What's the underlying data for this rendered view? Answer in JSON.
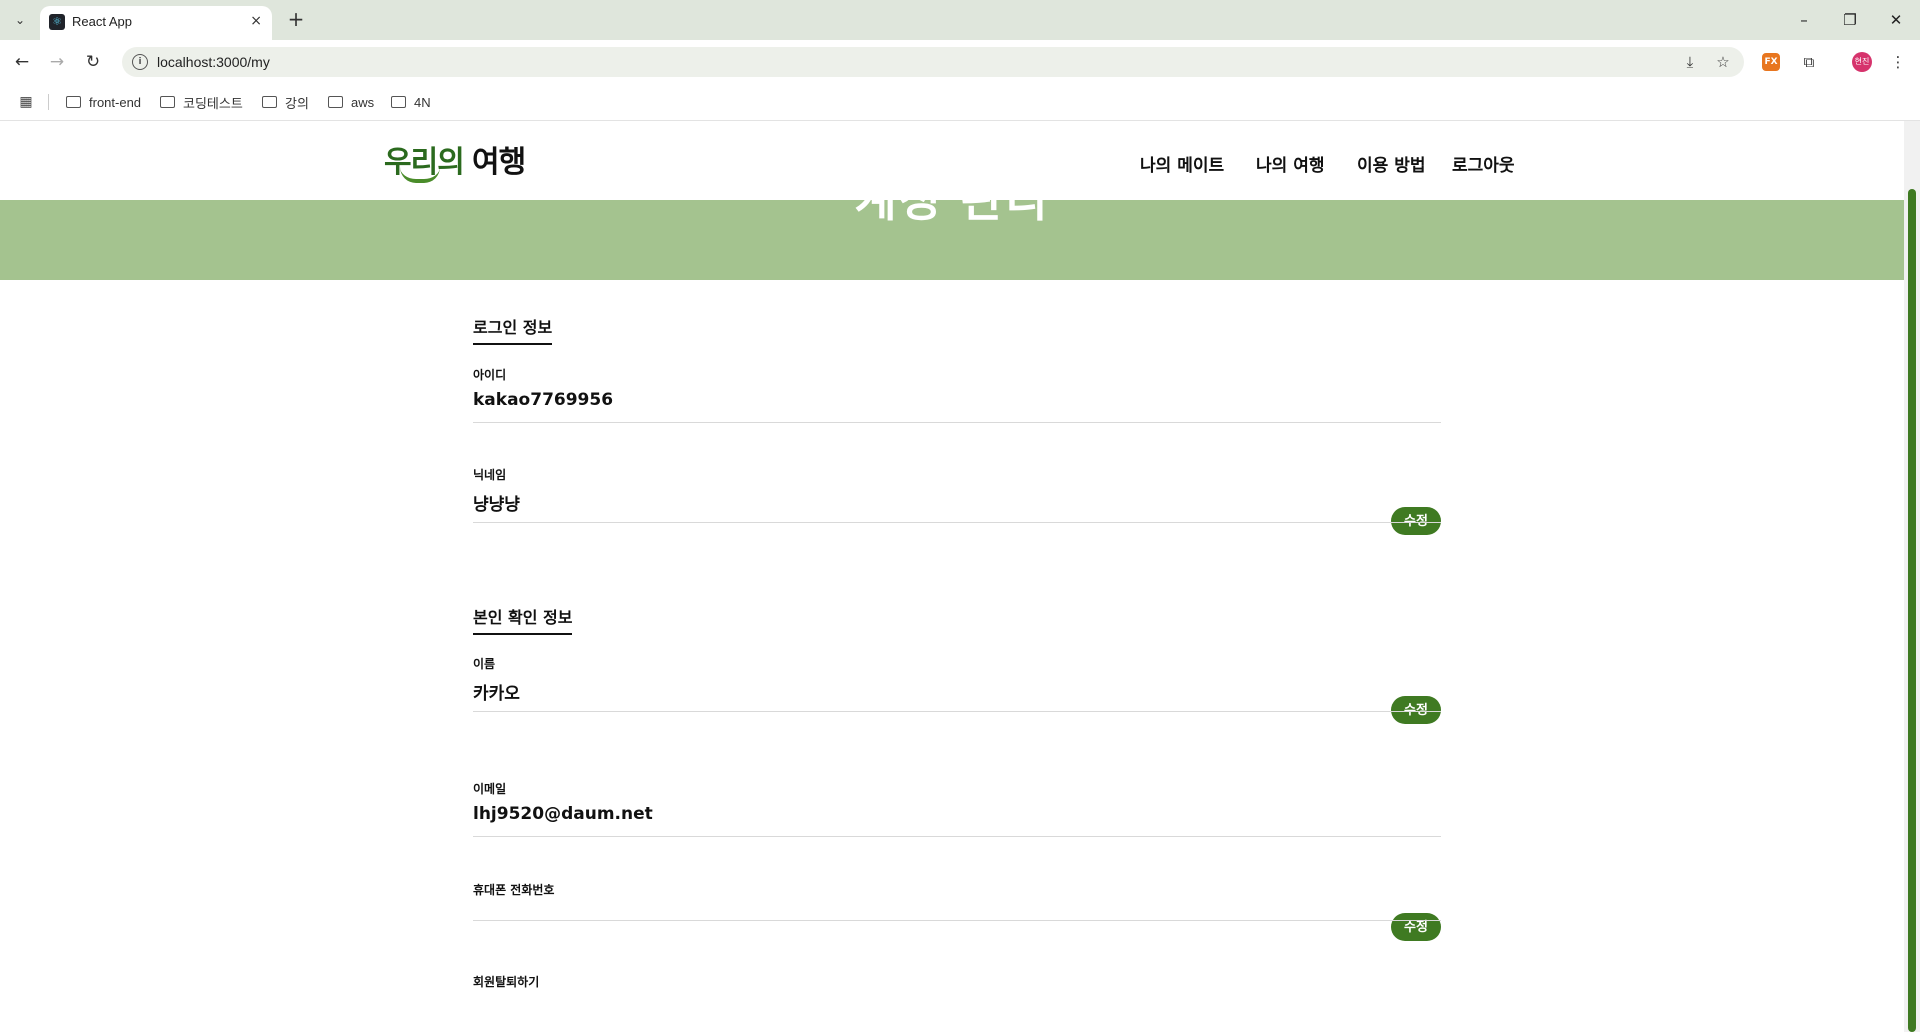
{
  "browser": {
    "tab_title": "React App",
    "tab_favicon": "react-icon",
    "tab_close": "×",
    "new_tab": "+",
    "url": "localhost:3000/my",
    "bookmarks": [
      "front-end",
      "코딩테스트",
      "강의",
      "aws",
      "4N"
    ],
    "window_controls": {
      "minimize": "–",
      "maximize": "❐",
      "close": "✕"
    },
    "extension_fx": "FX",
    "profile_initials": "현진"
  },
  "site": {
    "logo_part1": "우리의",
    "logo_part2": "여행",
    "nav": [
      "나의 메이트",
      "나의 여행",
      "이용 방법",
      "로그아웃"
    ]
  },
  "hero": {
    "title": "계정 관리"
  },
  "sections": {
    "login_info": {
      "title": "로그인 정보",
      "id_label": "아이디",
      "id_value": "kakao7769956",
      "nickname_label": "닉네임",
      "nickname_value": "냥냥냥",
      "edit_label": "수정"
    },
    "identity_info": {
      "title": "본인 확인 정보",
      "name_label": "이름",
      "name_value": "카카오",
      "email_label": "이메일",
      "email_value": "lhj9520@daum.net",
      "phone_label": "휴대폰 전화번호",
      "phone_value": "",
      "edit_label": "수정"
    },
    "withdraw_label": "회원탈퇴하기"
  },
  "colors": {
    "brand_green": "#3f7a22",
    "hero_green": "#a4c38f",
    "logo_green": "#2b6a1e"
  }
}
